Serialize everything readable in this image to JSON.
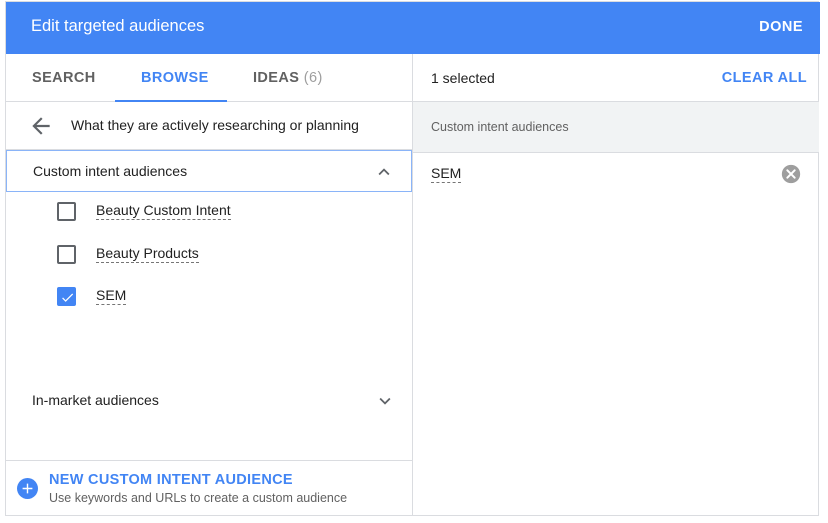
{
  "header": {
    "title": "Edit targeted audiences",
    "done_label": "DONE"
  },
  "tabs": [
    {
      "label": "SEARCH",
      "active": false
    },
    {
      "label": "BROWSE",
      "active": true
    },
    {
      "label": "IDEAS",
      "count": "(6)",
      "active": false
    }
  ],
  "breadcrumb": {
    "text": "What they are actively researching or planning"
  },
  "groups": [
    {
      "label": "Custom intent audiences",
      "expanded": true,
      "items": [
        {
          "label": "Beauty Custom Intent",
          "checked": false
        },
        {
          "label": "Beauty Products",
          "checked": false
        },
        {
          "label": "SEM",
          "checked": true
        }
      ]
    },
    {
      "label": "In-market audiences",
      "expanded": false
    }
  ],
  "footer": {
    "title": "NEW CUSTOM INTENT AUDIENCE",
    "subtitle": "Use keywords and URLs to create a custom audience"
  },
  "selection": {
    "count_text": "1 selected",
    "clear_label": "CLEAR ALL",
    "section_label": "Custom intent audiences",
    "items": [
      {
        "label": "SEM"
      }
    ]
  },
  "colors": {
    "accent": "#4285f4",
    "header_bg": "#4285f4",
    "section_bg": "#f1f3f4"
  },
  "icons": [
    "back-arrow-icon",
    "chevron-up-icon",
    "chevron-down-icon",
    "checkmark-icon",
    "plus-icon",
    "remove-circle-icon"
  ]
}
